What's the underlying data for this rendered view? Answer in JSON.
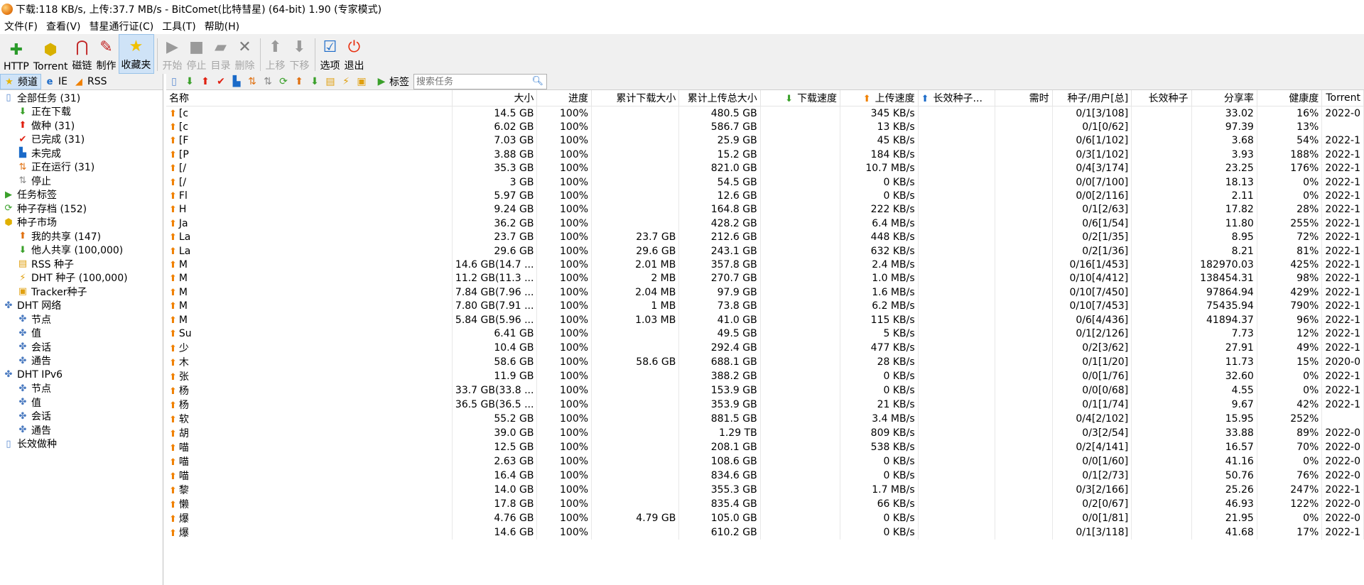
{
  "window": {
    "title": "下载:118 KB/s, 上传:37.7 MB/s - BitComet(比特彗星) (64-bit) 1.90 (专家模式)"
  },
  "menu": [
    "文件(F)",
    "查看(V)",
    "彗星通行证(C)",
    "工具(T)",
    "帮助(H)"
  ],
  "toolbar": {
    "buttons": [
      {
        "label": "HTTP",
        "icon": "add-http-icon"
      },
      {
        "label": "Torrent",
        "icon": "torrent-icon"
      },
      {
        "label": "磁链",
        "icon": "magnet-icon"
      },
      {
        "label": "制作",
        "icon": "make-torrent-icon"
      },
      {
        "label": "收藏夹",
        "icon": "star-icon"
      },
      {
        "label": "开始",
        "icon": "play-icon"
      },
      {
        "label": "停止",
        "icon": "stop-icon"
      },
      {
        "label": "目录",
        "icon": "folder-icon"
      },
      {
        "label": "删除",
        "icon": "delete-icon"
      },
      {
        "label": "上移",
        "icon": "move-up-icon"
      },
      {
        "label": "下移",
        "icon": "move-down-icon"
      },
      {
        "label": "选项",
        "icon": "options-icon"
      },
      {
        "label": "退出",
        "icon": "power-icon"
      }
    ]
  },
  "left_tabs": [
    "频道",
    "IE",
    "RSS"
  ],
  "tree": [
    {
      "label": "全部任务 (31)",
      "level": 0
    },
    {
      "label": "正在下载",
      "level": 1
    },
    {
      "label": "做种 (31)",
      "level": 1
    },
    {
      "label": "已完成 (31)",
      "level": 1
    },
    {
      "label": "未完成",
      "level": 1
    },
    {
      "label": "正在运行 (31)",
      "level": 1
    },
    {
      "label": "停止",
      "level": 1
    },
    {
      "label": "任务标签",
      "level": 0
    },
    {
      "label": "种子存档 (152)",
      "level": 0
    },
    {
      "label": "种子市场",
      "level": 0
    },
    {
      "label": "我的共享 (147)",
      "level": 1
    },
    {
      "label": "他人共享 (100,000)",
      "level": 1
    },
    {
      "label": "RSS 种子",
      "level": 1
    },
    {
      "label": "DHT 种子 (100,000)",
      "level": 1
    },
    {
      "label": "Tracker种子",
      "level": 1
    },
    {
      "label": "DHT 网络",
      "level": 0
    },
    {
      "label": "节点",
      "level": 1
    },
    {
      "label": "值",
      "level": 1
    },
    {
      "label": "会话",
      "level": 1
    },
    {
      "label": "通告",
      "level": 1
    },
    {
      "label": "DHT IPv6",
      "level": 0
    },
    {
      "label": "节点",
      "level": 1
    },
    {
      "label": "值",
      "level": 1
    },
    {
      "label": "会话",
      "level": 1
    },
    {
      "label": "通告",
      "level": 1
    },
    {
      "label": "长效做种",
      "level": 0
    }
  ],
  "subtoolbar": {
    "tag_label": "标签",
    "search_placeholder": "搜索任务"
  },
  "columns": [
    "名称",
    "大小",
    "进度",
    "累计下载大小",
    "累计上传总大小",
    "下载速度",
    "上传速度",
    "长效种子...",
    "需时",
    "种子/用户[总]",
    "长效种子",
    "分享率",
    "健康度",
    "Torrent"
  ],
  "rows": [
    [
      "[c",
      "14.5 GB",
      "100%",
      "",
      "480.5 GB",
      "",
      "345 KB/s",
      "",
      "",
      "0/1[3/108]",
      "",
      "33.02",
      "16%",
      "2022-0"
    ],
    [
      "[c",
      "6.02 GB",
      "100%",
      "",
      "586.7 GB",
      "",
      "13 KB/s",
      "",
      "",
      "0/1[0/62]",
      "",
      "97.39",
      "13%",
      ""
    ],
    [
      "[F",
      "7.03 GB",
      "100%",
      "",
      "25.9 GB",
      "",
      "45 KB/s",
      "",
      "",
      "0/6[1/102]",
      "",
      "3.68",
      "54%",
      "2022-1"
    ],
    [
      "[P",
      "3.88 GB",
      "100%",
      "",
      "15.2 GB",
      "",
      "184 KB/s",
      "",
      "",
      "0/3[1/102]",
      "",
      "3.93",
      "188%",
      "2022-1"
    ],
    [
      "[/",
      "35.3 GB",
      "100%",
      "",
      "821.0 GB",
      "",
      "10.7 MB/s",
      "",
      "",
      "0/4[3/174]",
      "",
      "23.25",
      "176%",
      "2022-1"
    ],
    [
      "[/",
      "3 GB",
      "100%",
      "",
      "54.5 GB",
      "",
      "0 KB/s",
      "",
      "",
      "0/0[7/100]",
      "",
      "18.13",
      "0%",
      "2022-1"
    ],
    [
      "Fl",
      "5.97 GB",
      "100%",
      "",
      "12.6 GB",
      "",
      "0 KB/s",
      "",
      "",
      "0/0[2/116]",
      "",
      "2.11",
      "0%",
      "2022-1"
    ],
    [
      "H",
      "9.24 GB",
      "100%",
      "",
      "164.8 GB",
      "",
      "222 KB/s",
      "",
      "",
      "0/1[2/63]",
      "",
      "17.82",
      "28%",
      "2022-1"
    ],
    [
      "Ja",
      "36.2 GB",
      "100%",
      "",
      "428.2 GB",
      "",
      "6.4 MB/s",
      "",
      "",
      "0/6[1/54]",
      "",
      "11.80",
      "255%",
      "2022-1"
    ],
    [
      "La",
      "23.7 GB",
      "100%",
      "23.7 GB",
      "212.6 GB",
      "",
      "448 KB/s",
      "",
      "",
      "0/2[1/35]",
      "",
      "8.95",
      "72%",
      "2022-1"
    ],
    [
      "La",
      "29.6 GB",
      "100%",
      "29.6 GB",
      "243.1 GB",
      "",
      "632 KB/s",
      "",
      "",
      "0/2[1/36]",
      "",
      "8.21",
      "81%",
      "2022-1"
    ],
    [
      "M",
      "14.6 GB(14.7 ...",
      "100%",
      "2.01 MB",
      "357.8 GB",
      "",
      "2.4 MB/s",
      "",
      "",
      "0/16[1/453]",
      "",
      "182970.03",
      "425%",
      "2022-1"
    ],
    [
      "M",
      "11.2 GB(11.3 ...",
      "100%",
      "2 MB",
      "270.7 GB",
      "",
      "1.0 MB/s",
      "",
      "",
      "0/10[4/412]",
      "",
      "138454.31",
      "98%",
      "2022-1"
    ],
    [
      "M",
      "7.84 GB(7.96 ...",
      "100%",
      "2.04 MB",
      "97.9 GB",
      "",
      "1.6 MB/s",
      "",
      "",
      "0/10[7/450]",
      "",
      "97864.94",
      "429%",
      "2022-1"
    ],
    [
      "M",
      "7.80 GB(7.91 ...",
      "100%",
      "1 MB",
      "73.8 GB",
      "",
      "6.2 MB/s",
      "",
      "",
      "0/10[7/453]",
      "",
      "75435.94",
      "790%",
      "2022-1"
    ],
    [
      "M",
      "5.84 GB(5.96 ...",
      "100%",
      "1.03 MB",
      "41.0 GB",
      "",
      "115 KB/s",
      "",
      "",
      "0/6[4/436]",
      "",
      "41894.37",
      "96%",
      "2022-1"
    ],
    [
      "Su",
      "6.41 GB",
      "100%",
      "",
      "49.5 GB",
      "",
      "5 KB/s",
      "",
      "",
      "0/1[2/126]",
      "",
      "7.73",
      "12%",
      "2022-1"
    ],
    [
      "少",
      "10.4 GB",
      "100%",
      "",
      "292.4 GB",
      "",
      "477 KB/s",
      "",
      "",
      "0/2[3/62]",
      "",
      "27.91",
      "49%",
      "2022-1"
    ],
    [
      "木",
      "58.6 GB",
      "100%",
      "58.6 GB",
      "688.1 GB",
      "",
      "28 KB/s",
      "",
      "",
      "0/1[1/20]",
      "",
      "11.73",
      "15%",
      "2020-0"
    ],
    [
      "张",
      "11.9 GB",
      "100%",
      "",
      "388.2 GB",
      "",
      "0 KB/s",
      "",
      "",
      "0/0[1/76]",
      "",
      "32.60",
      "0%",
      "2022-1"
    ],
    [
      "杨",
      "33.7 GB(33.8 ...",
      "100%",
      "",
      "153.9 GB",
      "",
      "0 KB/s",
      "",
      "",
      "0/0[0/68]",
      "",
      "4.55",
      "0%",
      "2022-1"
    ],
    [
      "杨",
      "36.5 GB(36.5 ...",
      "100%",
      "",
      "353.9 GB",
      "",
      "21 KB/s",
      "",
      "",
      "0/1[1/74]",
      "",
      "9.67",
      "42%",
      "2022-1"
    ],
    [
      "软",
      "55.2 GB",
      "100%",
      "",
      "881.5 GB",
      "",
      "3.4 MB/s",
      "",
      "",
      "0/4[2/102]",
      "",
      "15.95",
      "252%",
      ""
    ],
    [
      "胡",
      "39.0 GB",
      "100%",
      "",
      "1.29 TB",
      "",
      "809 KB/s",
      "",
      "",
      "0/3[2/54]",
      "",
      "33.88",
      "89%",
      "2022-0"
    ],
    [
      "喵",
      "12.5 GB",
      "100%",
      "",
      "208.1 GB",
      "",
      "538 KB/s",
      "",
      "",
      "0/2[4/141]",
      "",
      "16.57",
      "70%",
      "2022-0"
    ],
    [
      "喵",
      "2.63 GB",
      "100%",
      "",
      "108.6 GB",
      "",
      "0 KB/s",
      "",
      "",
      "0/0[1/60]",
      "",
      "41.16",
      "0%",
      "2022-0"
    ],
    [
      "喵",
      "16.4 GB",
      "100%",
      "",
      "834.6 GB",
      "",
      "0 KB/s",
      "",
      "",
      "0/1[2/73]",
      "",
      "50.76",
      "76%",
      "2022-0"
    ],
    [
      "黎",
      "14.0 GB",
      "100%",
      "",
      "355.3 GB",
      "",
      "1.7 MB/s",
      "",
      "",
      "0/3[2/166]",
      "",
      "25.26",
      "247%",
      "2022-1"
    ],
    [
      "懒",
      "17.8 GB",
      "100%",
      "",
      "835.4 GB",
      "",
      "66 KB/s",
      "",
      "",
      "0/2[0/67]",
      "",
      "46.93",
      "122%",
      "2022-0"
    ],
    [
      "爆",
      "4.76 GB",
      "100%",
      "4.79 GB",
      "105.0 GB",
      "",
      "0 KB/s",
      "",
      "",
      "0/0[1/81]",
      "",
      "21.95",
      "0%",
      "2022-0"
    ],
    [
      "爆",
      "14.6 GB",
      "100%",
      "",
      "610.2 GB",
      "",
      "0 KB/s",
      "",
      "",
      "0/1[3/118]",
      "",
      "41.68",
      "17%",
      "2022-1"
    ]
  ]
}
